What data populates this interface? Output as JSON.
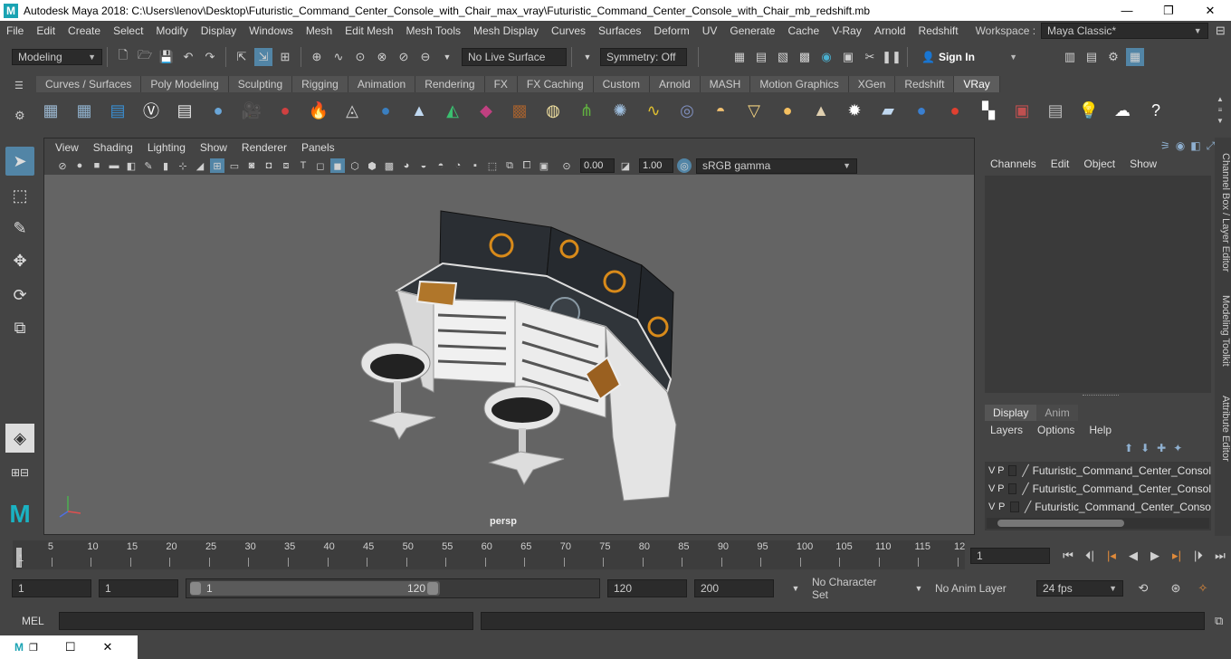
{
  "window": {
    "title": "Autodesk Maya 2018: C:\\Users\\lenov\\Desktop\\Futuristic_Command_Center_Console_with_Chair_max_vray\\Futuristic_Command_Center_Console_with_Chair_mb_redshift.mb",
    "minimize": "—",
    "maximize": "❐",
    "close": "✕"
  },
  "menubar": {
    "items": [
      "File",
      "Edit",
      "Create",
      "Select",
      "Modify",
      "Display",
      "Windows",
      "Mesh",
      "Edit Mesh",
      "Mesh Tools",
      "Mesh Display",
      "Curves",
      "Surfaces",
      "Deform",
      "UV",
      "Generate",
      "Cache",
      "V-Ray",
      "Arnold",
      "Redshift"
    ],
    "workspace_label": "Workspace :",
    "workspace_value": "Maya Classic*"
  },
  "statusline": {
    "mode": "Modeling",
    "live_surface": "No Live Surface",
    "symmetry": "Symmetry: Off",
    "sign_in": "Sign In"
  },
  "shelf": {
    "tabs": [
      "Curves / Surfaces",
      "Poly Modeling",
      "Sculpting",
      "Rigging",
      "Animation",
      "Rendering",
      "FX",
      "FX Caching",
      "Custom",
      "Arnold",
      "MASH",
      "Motion Graphics",
      "XGen",
      "Redshift",
      "VRay"
    ],
    "active_tab": "VRay",
    "icons": [
      {
        "name": "vray-light-dome-icon",
        "color": "#9bb7d0"
      },
      {
        "name": "vray-light-rect-icon",
        "color": "#8fb0cc"
      },
      {
        "name": "vray-frame-buffer-icon",
        "color": "#3a8fd4"
      },
      {
        "name": "vray-logo-icon",
        "color": "#ffffff"
      },
      {
        "name": "vray-render-settings-icon",
        "color": "#e8e8e8"
      },
      {
        "name": "vray-sphere-icon",
        "color": "#6aa6d8"
      },
      {
        "name": "vray-camera-icon",
        "color": "#333333"
      },
      {
        "name": "vray-material-icon",
        "color": "#d04040"
      },
      {
        "name": "vray-fire-icon",
        "color": "#f59a1a"
      },
      {
        "name": "vray-mesh-icon",
        "color": "#cccccc"
      },
      {
        "name": "vray-proxy-icon",
        "color": "#3a7fc0"
      },
      {
        "name": "vray-cone-icon",
        "color": "#c0d8f0"
      },
      {
        "name": "vray-rainbow-icon",
        "color": "#3ac070"
      },
      {
        "name": "vray-fur-icon",
        "color": "#c04080"
      },
      {
        "name": "vray-texture-icon",
        "color": "#a06030"
      },
      {
        "name": "vray-globe-icon",
        "color": "#f0e0a0"
      },
      {
        "name": "vray-grass-icon",
        "color": "#60b040"
      },
      {
        "name": "vray-particles-icon",
        "color": "#a0c0e0"
      },
      {
        "name": "vray-curve-icon",
        "color": "#e0c030"
      },
      {
        "name": "vray-wire-sphere-icon",
        "color": "#8090c0"
      },
      {
        "name": "vray-dome-light-icon",
        "color": "#f0c070"
      },
      {
        "name": "vray-spot-light-icon",
        "color": "#f0d080"
      },
      {
        "name": "vray-sun-icon",
        "color": "#f5c060"
      },
      {
        "name": "vray-ies-light-icon",
        "color": "#e0d0b0"
      },
      {
        "name": "vray-sunburst-icon",
        "color": "#ffffff"
      },
      {
        "name": "vray-plane-icon",
        "color": "#c0d8f0"
      },
      {
        "name": "vray-blue-sphere-icon",
        "color": "#3a7fd0"
      },
      {
        "name": "vray-flag-sphere-icon",
        "color": "#e04030"
      },
      {
        "name": "vray-checker-icon",
        "color": "#ffffff"
      },
      {
        "name": "vray-render-view-icon",
        "color": "#c05050"
      },
      {
        "name": "vray-table-icon",
        "color": "#bbbbbb"
      },
      {
        "name": "vray-bulb-icon",
        "color": "#f0e060"
      },
      {
        "name": "vray-cloud-icon",
        "color": "#ffffff"
      },
      {
        "name": "help-icon",
        "color": "#ffffff"
      }
    ]
  },
  "viewport": {
    "menu": [
      "View",
      "Shading",
      "Lighting",
      "Show",
      "Renderer",
      "Panels"
    ],
    "exposure": "0.00",
    "gamma": "1.00",
    "color_space": "sRGB gamma",
    "camera": "persp"
  },
  "channel_box": {
    "menu": [
      "Channels",
      "Edit",
      "Object",
      "Show"
    ]
  },
  "layer_editor": {
    "tabs": [
      "Display",
      "Anim"
    ],
    "active_tab": "Display",
    "menu": [
      "Layers",
      "Options",
      "Help"
    ],
    "layers": [
      {
        "v": "V",
        "p": "P",
        "name": "Futuristic_Command_Center_Consol"
      },
      {
        "v": "V",
        "p": "P",
        "name": "Futuristic_Command_Center_Consol"
      },
      {
        "v": "V",
        "p": "P",
        "name": "Futuristic_Command_Center_Conso"
      }
    ]
  },
  "side_tabs": [
    "Channel Box / Layer Editor",
    "Modeling Toolkit",
    "Attribute Editor"
  ],
  "timeline": {
    "tick_labels": [
      "1",
      "5",
      "10",
      "15",
      "20",
      "25",
      "30",
      "35",
      "40",
      "45",
      "50",
      "55",
      "60",
      "65",
      "70",
      "75",
      "80",
      "85",
      "90",
      "95",
      "100",
      "105",
      "110",
      "115",
      "12"
    ],
    "current_frame": "1"
  },
  "range": {
    "start": "1",
    "playback_start": "1",
    "slider_start": "1",
    "slider_end": "120",
    "playback_end": "120",
    "end": "200",
    "character_set": "No Character Set",
    "anim_layer": "No Anim Layer",
    "fps": "24 fps"
  },
  "command_line": {
    "label": "MEL"
  }
}
